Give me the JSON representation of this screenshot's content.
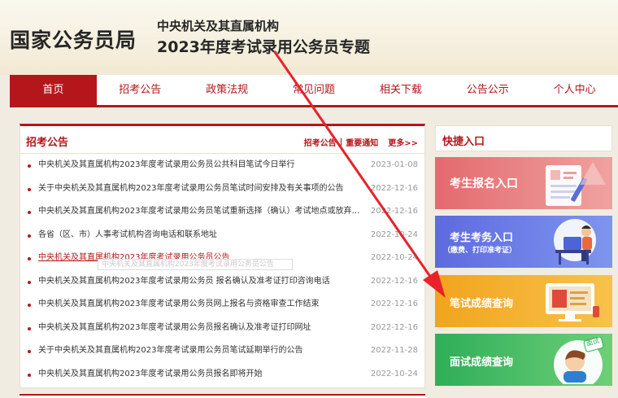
{
  "header": {
    "brand": "国家公务员局",
    "subtitle_line1": "中央机关及其直属机构",
    "subtitle_line2": "2023年度考试录用公务员专题"
  },
  "nav": {
    "items": [
      "首页",
      "招考公告",
      "政策法规",
      "常见问题",
      "相关下载",
      "公告公示",
      "个人中心"
    ],
    "active_index": 0
  },
  "announcements": {
    "title": "招考公告",
    "link1": "招考公告",
    "separator": "|",
    "link2": "重要通知",
    "more": "更多>>",
    "items": [
      {
        "title": "中央机关及其直属机构2023年度考试录用公务员公共科目笔试今日举行",
        "date": "2023-01-08"
      },
      {
        "title": "关于中央机关及其直属机构2023年度考试录用公务员笔试时间安排及有关事项的公告",
        "date": "2022-12-16"
      },
      {
        "title": "中央机关及其直属机构2023年度考试录用公务员笔试重新选择（确认）考试地点或放弃参...",
        "date": "2022-12-16"
      },
      {
        "title": "各省（区、市）人事考试机构咨询电话和联系地址",
        "date": "2022-10-24"
      },
      {
        "title": "中央机关及其直属机构2023年度考试录用公务员公告",
        "date": "2022-10-24"
      },
      {
        "title": "中央机关及其直属机构2023年度考试录用公务员 报名确认及准考证打印咨询电话",
        "date": "2022-12-16"
      },
      {
        "title": "中央机关及其直属机构2023年度考试录用公务员网上报名与资格审查工作结束",
        "date": "2022-12-16"
      },
      {
        "title": "中央机关及其直属机构2023年度考试录用公务员报名确认及准考证打印网址",
        "date": "2022-12-16"
      },
      {
        "title": "关于中央机关及其直属机构2023年度考试录用公务员笔试延期举行的公告",
        "date": "2022-11-28"
      },
      {
        "title": "中央机关及其直属机构2023年度考试录用公务员报名即将开始",
        "date": "2022-10-24"
      }
    ],
    "highlighted_index": 4,
    "tooltip_text": "中央机关及其直属机构2023年度考试录用公务员公告"
  },
  "quick_entry": {
    "title": "快捷入口",
    "buttons": [
      {
        "label": "考生报名入口",
        "icon": "registration-form-icon"
      },
      {
        "label": "考生考务入口",
        "sub": "（缴费、打印准考证）",
        "icon": "student-desk-icon"
      },
      {
        "label": "笔试成绩查询",
        "icon": "computer-scores-icon"
      },
      {
        "label": "面试成绩查询",
        "badge": "面试",
        "icon": "interview-person-icon"
      }
    ]
  },
  "colors": {
    "brand_red": "#b5161b",
    "btn_register": "#e36a6e",
    "btn_exam_affairs": "#5e6ae0",
    "btn_written_score": "#f2a41d",
    "btn_interview_score": "#2fae58",
    "annotation_arrow": "#e8222a"
  }
}
